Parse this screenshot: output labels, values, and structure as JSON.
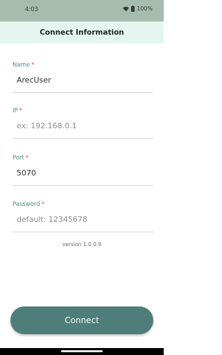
{
  "status_bar": {
    "time": "4:03",
    "battery": "100%",
    "wifi_icon": "wifi-icon",
    "battery_icon": "battery-icon"
  },
  "header": {
    "title": "Connect Information"
  },
  "form": {
    "name": {
      "label": "Name",
      "required": "*",
      "value": "ArecUser",
      "placeholder": ""
    },
    "ip": {
      "label": "IP",
      "required": "*",
      "value": "",
      "placeholder": "ex: 192.168.0.1"
    },
    "port": {
      "label": "Port",
      "required": "*",
      "value": "5070",
      "placeholder": ""
    },
    "password": {
      "label": "Password",
      "required": "*",
      "value": "",
      "placeholder": "default: 12345678"
    }
  },
  "version": "version 1.0.0.9",
  "connect_button": {
    "label": "Connect"
  },
  "colors": {
    "status_bar_bg": "#a6bcae",
    "header_bg": "#e4f6ef",
    "label": "#4e8b87",
    "required": "#e04b4b",
    "button_bg": "#4f7d7a"
  }
}
